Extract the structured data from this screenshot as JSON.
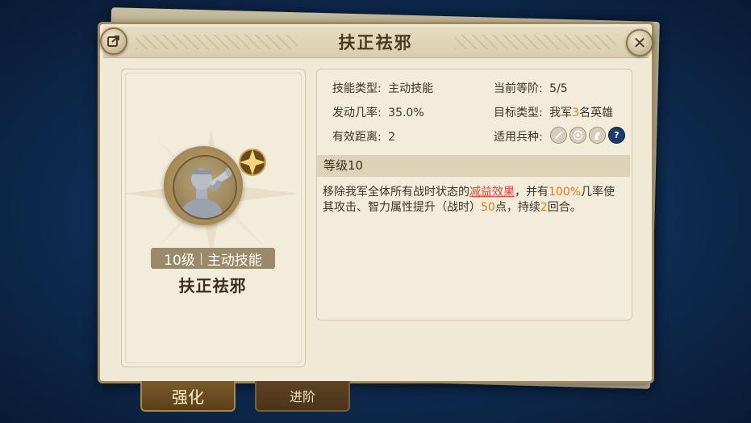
{
  "dialog": {
    "title": "扶正祛邪"
  },
  "skill_card": {
    "level_text": "10级",
    "type_text": "主动技能",
    "name": "扶正祛邪"
  },
  "info": {
    "skill_type_label": "技能类型:",
    "skill_type_value": "主动技能",
    "current_rank_label": "当前等阶:",
    "current_rank_value": "5/5",
    "trigger_rate_label": "发动几率:",
    "trigger_rate_value": "35.0%",
    "target_type_label": "目标类型:",
    "target_prefix": "我军",
    "target_count": "3",
    "target_suffix": "名英雄",
    "range_label": "有效距离:",
    "range_value": "2",
    "troop_label": "适用兵种:",
    "troop_icons": [
      "sword-icon",
      "target-icon",
      "horse-icon",
      "help-icon"
    ],
    "help_symbol": "?"
  },
  "level_section": {
    "header": "等级10",
    "desc_part1": "移除我军全体所有战时状态的",
    "desc_debuff": "减益效果",
    "desc_part2": "，并有",
    "desc_rate": "100%",
    "desc_part3": "几率使其攻击、智力属性提升（战时）",
    "desc_points": "50",
    "desc_part4": "点，持续",
    "desc_rounds": "2",
    "desc_part5": "回合。"
  },
  "tabs": [
    {
      "label": "强化",
      "active": true
    },
    {
      "label": "进阶",
      "active": false
    }
  ],
  "colors": {
    "highlight": "#e07a1a",
    "debuff": "#e2473d",
    "panel": "#efe9d6"
  }
}
